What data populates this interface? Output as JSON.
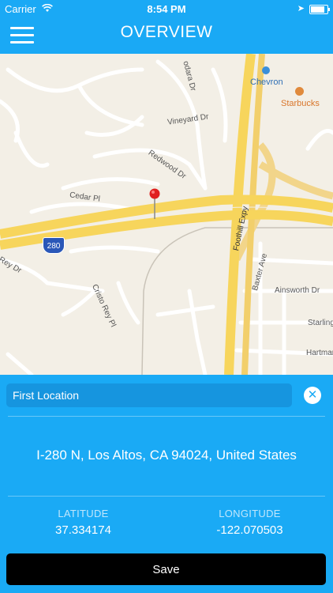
{
  "status_bar": {
    "carrier": "Carrier",
    "time": "8:54 PM"
  },
  "nav": {
    "title": "OVERVIEW"
  },
  "map": {
    "labels": {
      "streets": [
        "odara Dr",
        "Vineyard Dr",
        "Redwood Dr",
        "Cedar Pl",
        "Rey Dr",
        "Cristo Rey Pl",
        "Foothill Expy",
        "Baxter Ave",
        "Ainsworth Dr",
        "Starling",
        "Hartman"
      ],
      "pois": [
        "Chevron",
        "Starbucks"
      ],
      "shield": "280"
    }
  },
  "location": {
    "name_value": "First Location",
    "address": "I-280 N, Los Altos, CA  94024, United States",
    "latitude_label": "LATITUDE",
    "latitude": "37.334174",
    "longitude_label": "LONGITUDE",
    "longitude": "-122.070503"
  },
  "actions": {
    "save_label": "Save"
  },
  "colors": {
    "accent": "#1aaaf5",
    "field_bg": "#1695df",
    "save_bg": "#000000",
    "highway": "#f7d55c",
    "map_bg": "#f3efe6"
  }
}
